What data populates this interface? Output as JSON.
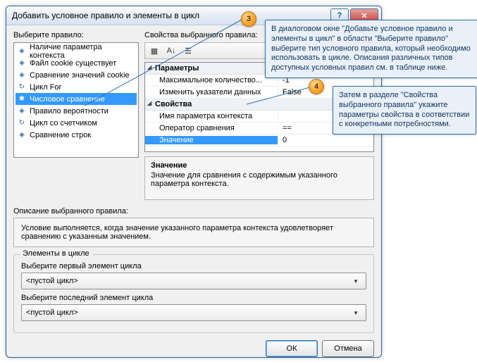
{
  "dialog": {
    "title": "Добавить условное правило и элементы в цикл",
    "choose_rule_label": "Выберите правило:",
    "properties_label": "Свойства выбранного правила:",
    "rules": [
      {
        "icon": "◈",
        "label": "Наличие параметра контекста"
      },
      {
        "icon": "◈",
        "label": "Файл cookie существует"
      },
      {
        "icon": "◈",
        "label": "Сравнение значений cookie"
      },
      {
        "icon": "↻",
        "label": "Цикл For"
      },
      {
        "icon": "✱",
        "label": "Числовое сравнение"
      },
      {
        "icon": "◈",
        "label": "Правило вероятности"
      },
      {
        "icon": "↻",
        "label": "Цикл со счетчиком"
      },
      {
        "icon": "◈",
        "label": "Сравнение строк"
      }
    ],
    "selected_rule_index": 4,
    "toolbar": {
      "cat": "▦",
      "az": "A↓",
      "alpha": "☰"
    },
    "prop_grid": {
      "cat_params": "Параметры",
      "max_count_name": "Максимальное количество...",
      "max_count_val": "-1",
      "change_ptr_name": "Изменить указатели данных",
      "change_ptr_val": "False",
      "cat_props": "Свойства",
      "ctx_param_name": "Имя параметра контекста",
      "ctx_param_val": "",
      "op_name": "Оператор сравнения",
      "op_val": "==",
      "value_name": "Значение",
      "value_val": "0"
    },
    "desc": {
      "header": "Значение",
      "body": "Значение для сравнения с содержимым указанного параметра контекста."
    },
    "rule_desc_label": "Описание выбранного правила:",
    "rule_desc_body": "Условие выполняется, когда значение указанного параметра контекста удовлетворяет сравнению с указанным значением.",
    "loop_group": {
      "legend": "Элементы в цикле",
      "first_label": "Выберите первый элемент цикла",
      "first_value": "<пустой цикл>",
      "last_label": "Выберите последний элемент цикла",
      "last_value": "<пустой цикл>"
    },
    "buttons": {
      "ok": "ОК",
      "cancel": "Отмена"
    }
  },
  "callouts": {
    "n3": "3",
    "t3": "В диалоговом окне \"Добавьте условное правило и элементы в цикл\" в области \"Выберите правило\" выберите тип условного правила, который необходимо использовать в цикле. Описания различных типов доступных условных правил см. в таблице ниже.",
    "n4": "4",
    "t4": "Затем в разделе \"Свойства выбранного правила\" укажите параметры свойства в соответствии с конкретными потребностями."
  }
}
